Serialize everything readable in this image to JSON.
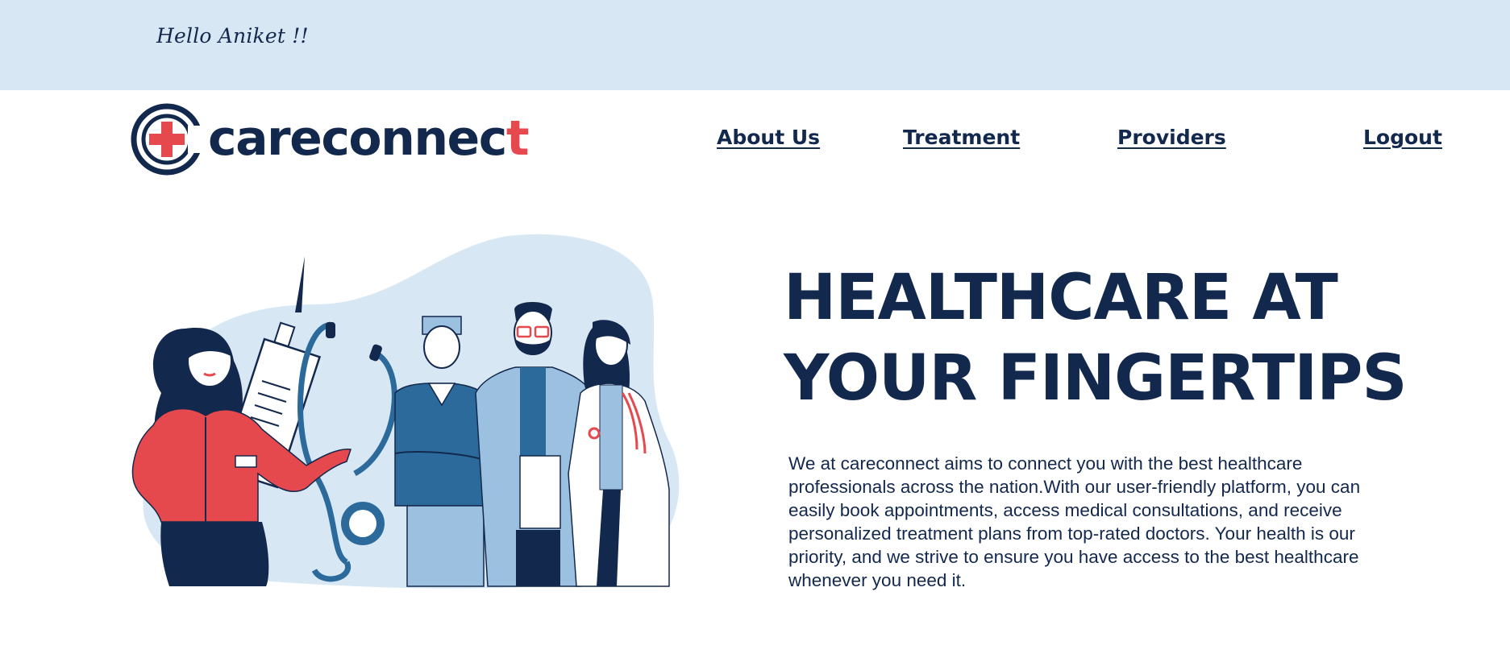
{
  "header": {
    "greeting": "Hello Aniket !!"
  },
  "brand": {
    "name_main": "careconnec",
    "name_last": "t",
    "logo_icon": "medical-cross-icon",
    "colors": {
      "navy": "#13284d",
      "red": "#e5484d",
      "light_blue": "#d7e8f4"
    }
  },
  "nav": {
    "about": "About Us",
    "treatment": "Treatment",
    "providers": "Providers",
    "logout": "Logout"
  },
  "hero": {
    "title_line1": "HEALTHCARE AT",
    "title_line2": "YOUR FINGERTIPS",
    "description": "We at careconnect aims to connect you with the best healthcare professionals across the nation.With our user-friendly platform, you can easily book appointments, access medical consultations, and receive personalized treatment plans from top-rated doctors. Your health is our priority, and we strive to ensure you have access to the best healthcare whenever you need it.",
    "illustration": "medical-team-illustration"
  }
}
